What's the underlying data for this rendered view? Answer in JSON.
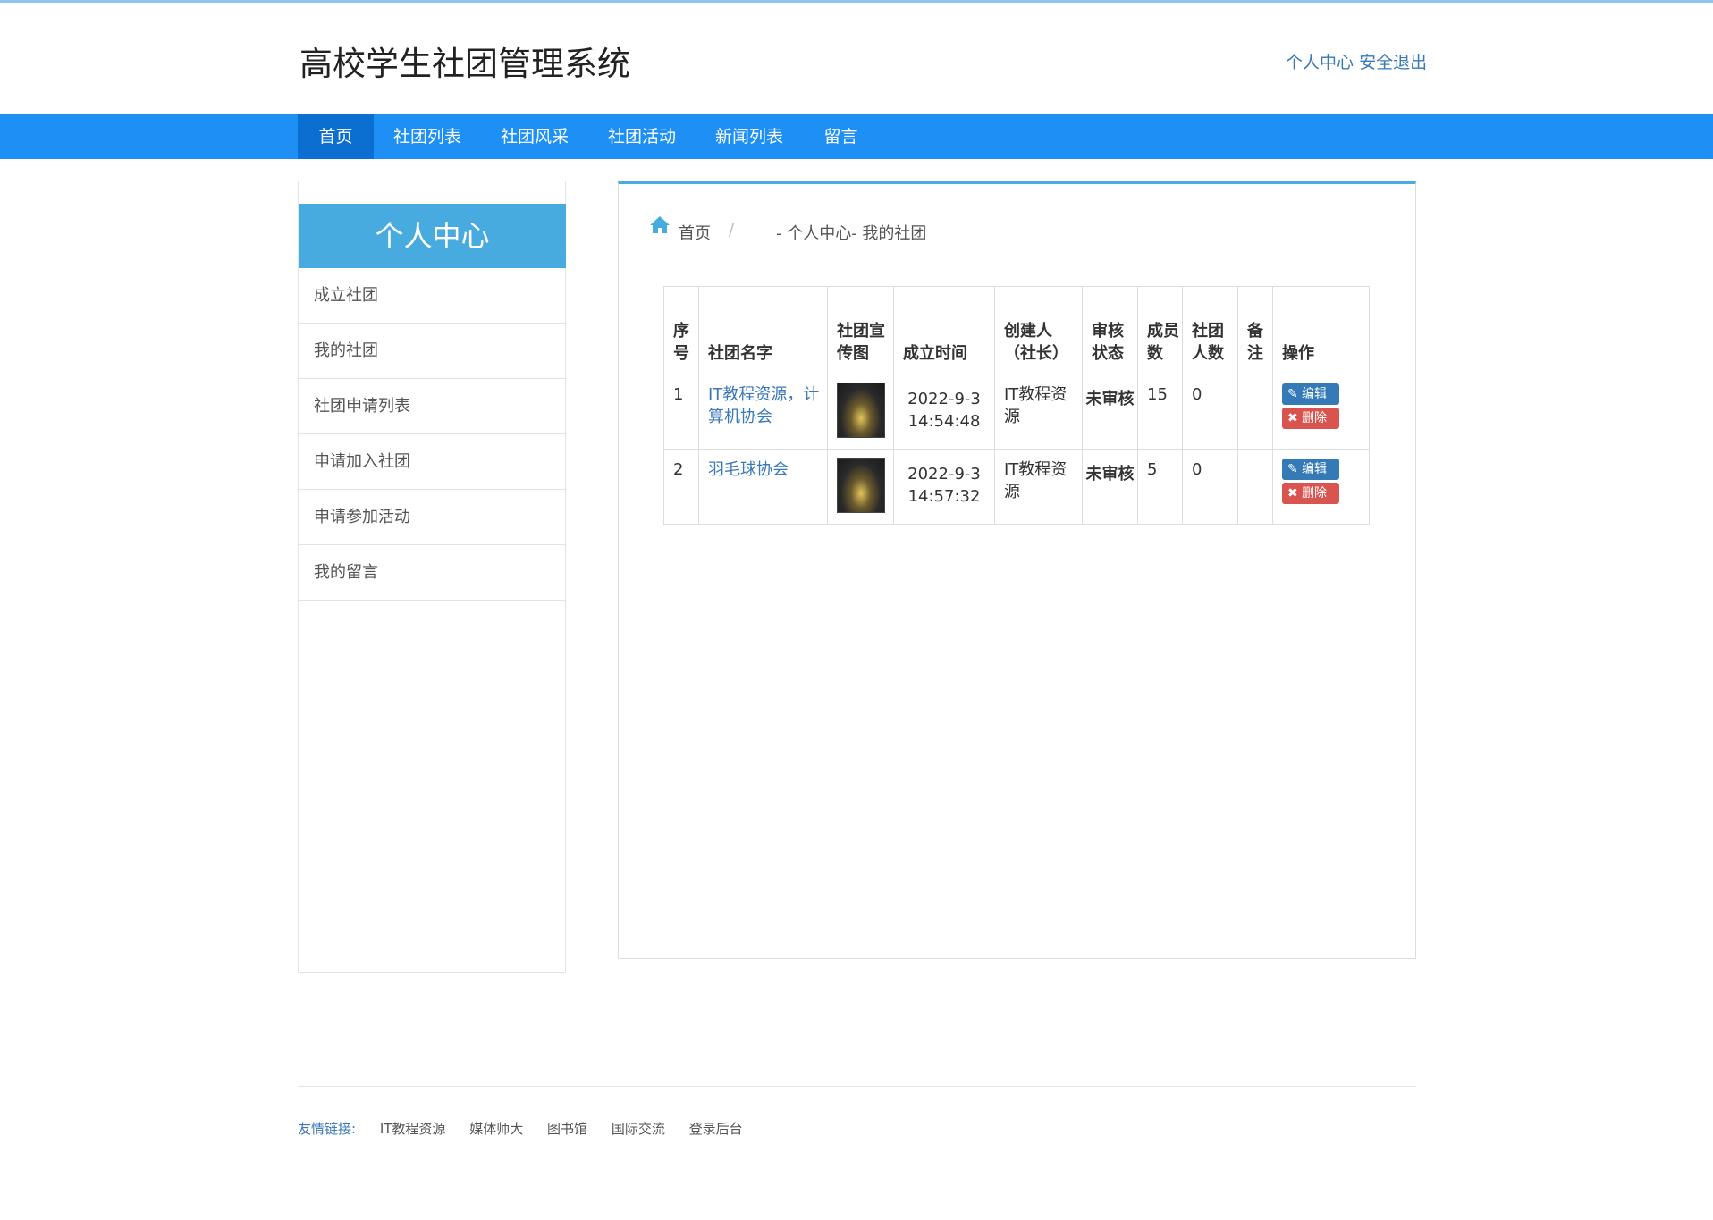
{
  "header": {
    "title": "高校学生社团管理系统",
    "user_center": "个人中心",
    "logout": "安全退出"
  },
  "nav": [
    "首页",
    "社团列表",
    "社团风采",
    "社团活动",
    "新闻列表",
    "留言"
  ],
  "sidebar": {
    "title": "个人中心",
    "items": [
      "成立社团",
      "我的社团",
      "社团申请列表",
      "申请加入社团",
      "申请参加活动",
      "我的留言"
    ]
  },
  "breadcrumb": {
    "home": "首页",
    "separator": "/",
    "path": "- 个人中心- 我的社团"
  },
  "table": {
    "headers": [
      "序号",
      "社团名字",
      "社团宣传图",
      "成立时间",
      "创建人（社长）",
      "审核状态",
      "成员数",
      "社团人数",
      "备注",
      "操作"
    ],
    "rows": [
      {
        "index": "1",
        "name": "IT教程资源，计算机协会",
        "date": "2022-9-3",
        "time": "14:54:48",
        "creator": "IT教程资源",
        "status": "未审核",
        "members": "15",
        "count": "0",
        "note": ""
      },
      {
        "index": "2",
        "name": "羽毛球协会",
        "date": "2022-9-3",
        "time": "14:57:32",
        "creator": "IT教程资源",
        "status": "未审核",
        "members": "5",
        "count": "0",
        "note": ""
      }
    ],
    "edit_label": "编辑",
    "delete_label": "删除"
  },
  "footer": {
    "label": "友情链接:",
    "links": [
      "IT教程资源",
      "媒体师大",
      "图书馆",
      "国际交流",
      "登录后台"
    ]
  },
  "colors": {
    "nav": "#1e90f5",
    "nav_active": "#0b6fd2",
    "side_head": "#48abdf",
    "status": "#e36c1a",
    "date": "#3c8a2e"
  }
}
